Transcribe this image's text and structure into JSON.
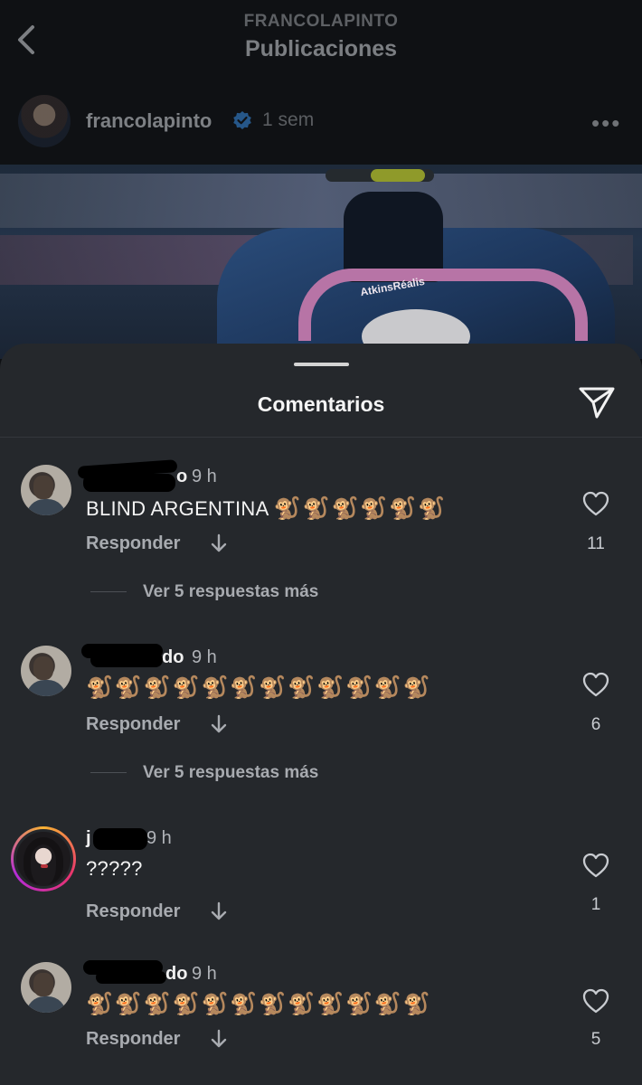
{
  "header": {
    "account_caps": "FRANCOLAPINTO",
    "title": "Publicaciones",
    "back_icon": "chevron-left-icon"
  },
  "post": {
    "username": "francolapinto",
    "verified": true,
    "time": "1 sem",
    "more_icon": "more-horizontal-icon",
    "photo_sponsor_text": "AtkinsRéalis"
  },
  "sheet": {
    "title": "Comentarios",
    "share_icon": "paper-plane-icon"
  },
  "comments": [
    {
      "name_visible": "o",
      "time": "9 h",
      "text": "BLIND ARGENTINA",
      "emoji": "🐒🐒🐒🐒🐒🐒",
      "reply_label": "Responder",
      "likes": "11",
      "more_replies": "Ver 5 respuestas más"
    },
    {
      "name_visible": "do",
      "time": "9 h",
      "text": "",
      "emoji": "🐒🐒🐒🐒🐒🐒🐒🐒🐒🐒🐒🐒",
      "reply_label": "Responder",
      "likes": "6",
      "more_replies": "Ver 5 respuestas más"
    },
    {
      "name_visible": "j",
      "time": "9 h",
      "text": "?????",
      "emoji": "",
      "reply_label": "Responder",
      "likes": "1"
    },
    {
      "name_visible": "do",
      "time": "9 h",
      "text": "",
      "emoji": "🐒🐒🐒🐒🐒🐒🐒🐒🐒🐒🐒🐒",
      "reply_label": "Responder",
      "likes": "5"
    }
  ],
  "colors": {
    "sheet_bg": "#25282c",
    "page_bg": "#0f1114",
    "verified_blue": "#3897f0",
    "story_ring_start": "#f9b233",
    "story_ring_end": "#b42bd8"
  }
}
